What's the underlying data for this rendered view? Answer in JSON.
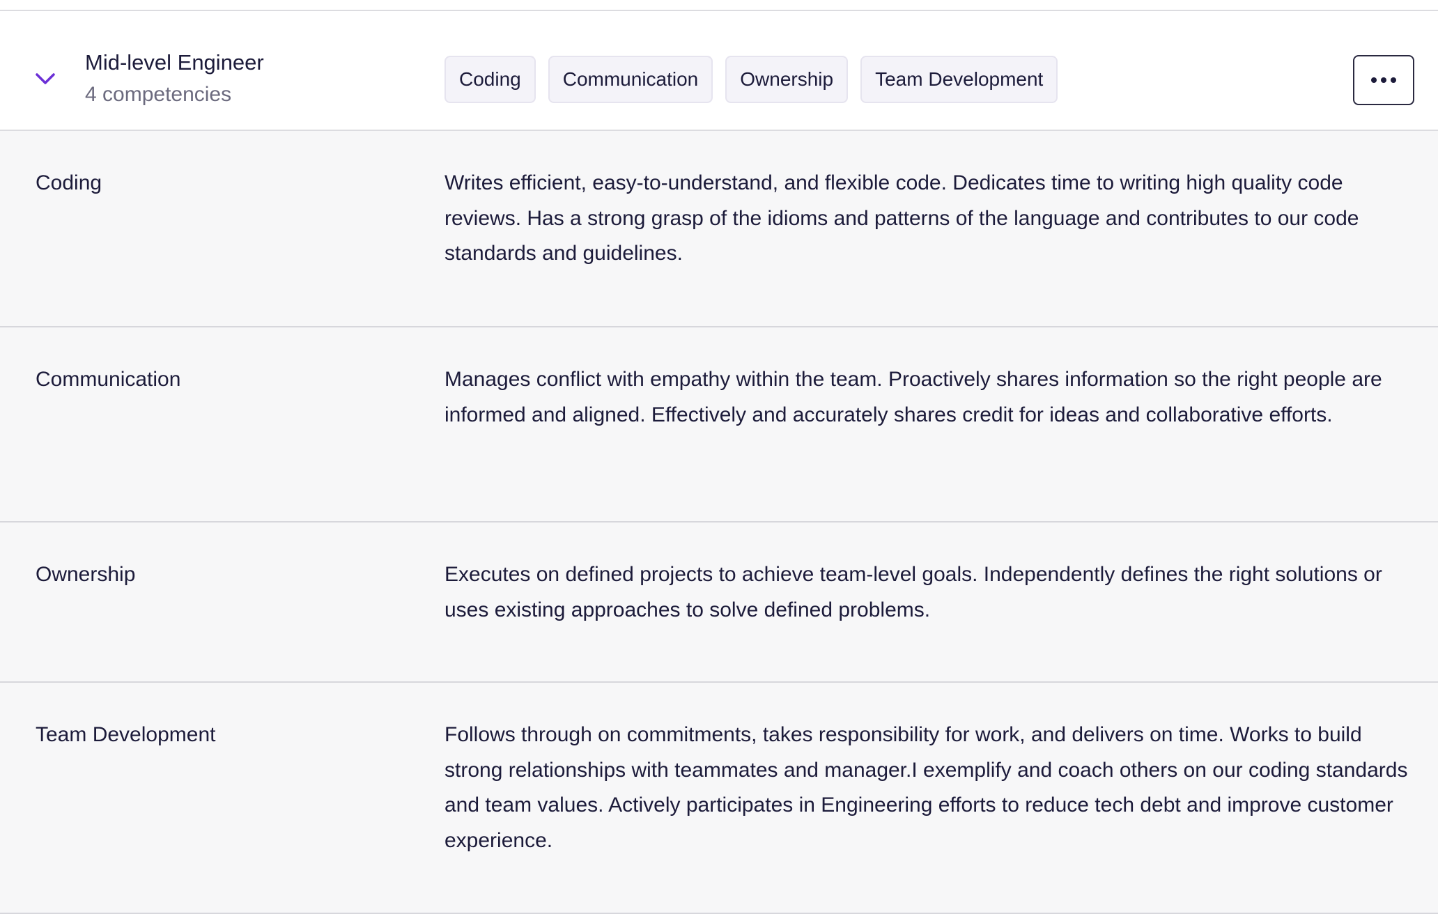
{
  "level": {
    "title": "Mid-level Engineer",
    "subtitle": "4 competencies",
    "expand_icon": "chevron-down-icon",
    "tags": [
      "Coding",
      "Communication",
      "Ownership",
      "Team Development"
    ],
    "more_icon": "more-horizontal-icon"
  },
  "competencies": [
    {
      "name": "Coding",
      "description": "Writes efficient, easy-to-understand, and flexible code. Dedicates time to writing high quality code reviews. Has a strong grasp of the idioms and patterns of the language and contributes to our code standards and guidelines."
    },
    {
      "name": "Communication",
      "description": "Manages conflict with empathy within the team. Proactively shares information so the right people are informed and aligned. Effectively and accurately shares credit for ideas and collaborative efforts."
    },
    {
      "name": "Ownership",
      "description": "Executes on defined projects to achieve team-level goals. Independently defines the right solutions or uses existing approaches to solve defined problems."
    },
    {
      "name": "Team Development",
      "description": "Follows through on commitments, takes responsibility for work, and delivers on time. Works to build strong relationships with teammates and manager.I exemplify and coach others on our coding standards and team values. Actively participates in Engineering efforts to reduce tech debt and improve customer experience."
    }
  ],
  "colors": {
    "accent": "#6b2fd6",
    "text": "#1c1b3a",
    "muted": "#6b6a7e",
    "row_background": "#f7f7f8",
    "tag_background": "#f4f3f9"
  }
}
